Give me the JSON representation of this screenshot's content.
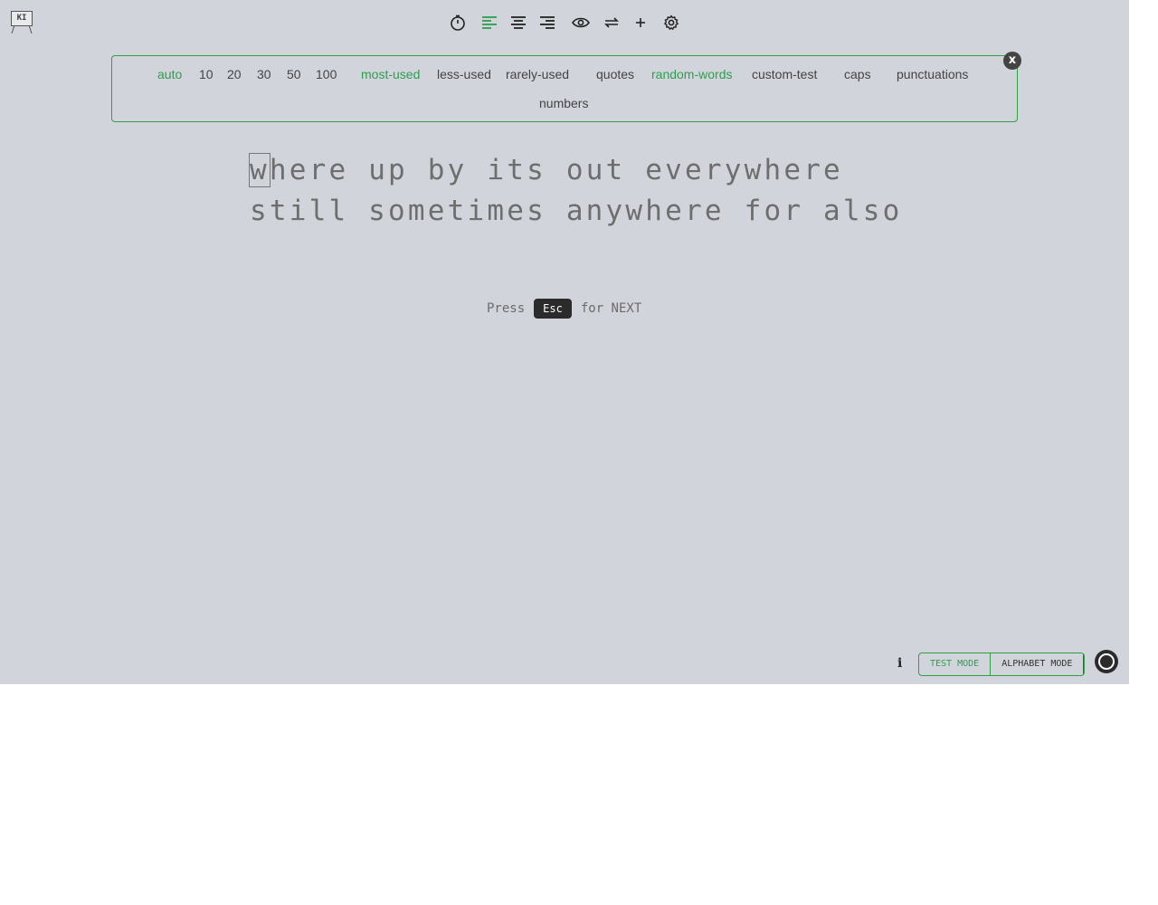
{
  "logo": {
    "text": "KI"
  },
  "toolbar": {
    "items": [
      {
        "icon": "timer-icon"
      },
      {
        "icon": "align-left-icon",
        "active": true
      },
      {
        "icon": "align-center-icon"
      },
      {
        "icon": "align-right-icon"
      },
      {
        "icon": "eye-icon"
      },
      {
        "icon": "swap-icon"
      },
      {
        "icon": "plus-icon"
      },
      {
        "icon": "gear-icon"
      }
    ]
  },
  "options": {
    "counts": [
      "auto",
      "10",
      "20",
      "30",
      "50",
      "100"
    ],
    "categories": [
      "most-used",
      "less-used",
      "rarely-used"
    ],
    "modes": [
      "quotes",
      "random-words",
      "custom-test"
    ],
    "modifiers": [
      "caps",
      "punctuations"
    ],
    "extra": [
      "numbers"
    ],
    "active": [
      "auto",
      "most-used",
      "random-words"
    ]
  },
  "close_label": "x",
  "words": {
    "line1": "where up by its out everywhere",
    "line2": "still sometimes anywhere for also"
  },
  "hint": {
    "press": "Press",
    "key": "Esc",
    "suffix": "for NEXT"
  },
  "footer": {
    "info": "i",
    "test_mode": "TEST MODE",
    "alphabet_mode": "ALPHABET MODE"
  },
  "colors": {
    "accent": "#2e9e4f",
    "background": "#d1d4db",
    "text": "#6e6e6e"
  }
}
